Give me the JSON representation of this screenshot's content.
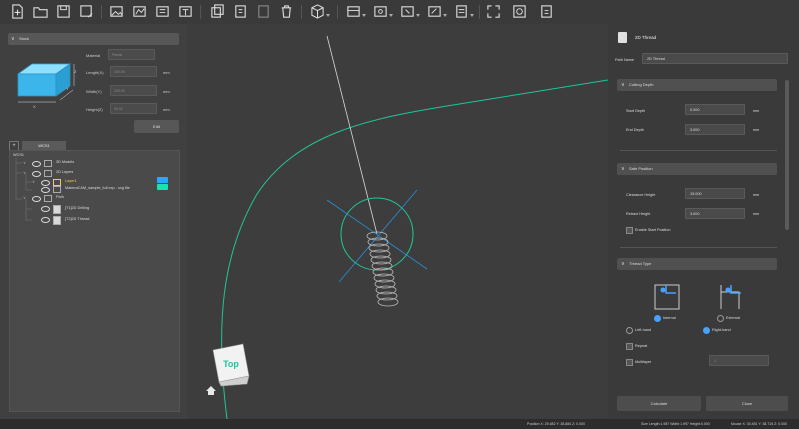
{
  "stock": {
    "header": "Stock",
    "material_label": "Material",
    "material_value": "Plastic",
    "length_label": "Length(X)",
    "length_value": "200.00",
    "width_label": "Width(Y)",
    "width_value": "200.00",
    "height_label": "Height(Z)",
    "height_value": "20.00",
    "unit": "mm",
    "edit_label": "Edit",
    "axis_x": "X",
    "axis_y": "Y",
    "axis_z": "Z"
  },
  "tree": {
    "tab_label": "WCS1",
    "root": "WCS1",
    "items": [
      {
        "label": "3D Models"
      },
      {
        "label": "2D Layers"
      },
      {
        "label": "Layer1"
      },
      {
        "label": "MakeraCAM_sample_full.exp - svg file"
      },
      {
        "label": "Path"
      },
      {
        "label": "[T1]2D Drilling"
      },
      {
        "label": "[T2]2D Thread"
      }
    ],
    "swatch_colors": [
      "#2aa8ff",
      "#20e0b0"
    ]
  },
  "viewport": {
    "cube_label": "Top",
    "path_color": "#1fc69a",
    "helix_color": "#bbbbbb"
  },
  "panel": {
    "title": "2D Thread",
    "path_name_label": "Path Name",
    "path_name_value": "2D Thread",
    "cutting_depth": {
      "header": "Cutting Depth",
      "start_label": "Start Depth",
      "start_value": "0.000",
      "end_label": "End Depth",
      "end_value": "3.000",
      "unit": "mm"
    },
    "safe_position": {
      "header": "Safe Position",
      "clearance_label": "Clearance Height",
      "clearance_value": "15.000",
      "retract_label": "Retract Height",
      "retract_value": "3.000",
      "unit": "mm",
      "enable_start_label": "Enable Start Position"
    },
    "thread_type": {
      "header": "Thread Type",
      "internal_label": "Internal",
      "external_label": "External",
      "left_hand_label": "Left-hand",
      "right_hand_label": "Right-hand",
      "repeat_label": "Repeat",
      "multilayer_label": "Multilayer",
      "multilayer_value": "1"
    },
    "calculate_label": "Calculate",
    "close_label": "Close"
  },
  "status": {
    "position": "Position X: 29.482 Y: 38.884 Z: 0.000",
    "size": "Size Length:1.987 Width:1.997 Height:0.000",
    "mouse": "Mouse X: 30.451 Y: 38.715 Z: 0.000"
  },
  "colors": {
    "accent": "#4aa0ff",
    "path": "#1fc69a"
  }
}
